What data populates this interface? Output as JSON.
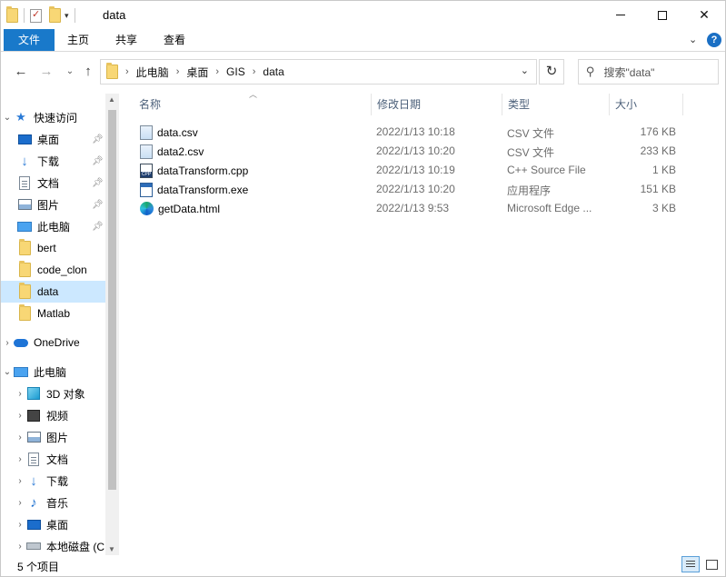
{
  "window": {
    "title": "data"
  },
  "ribbon": {
    "tabs": [
      "文件",
      "主页",
      "共享",
      "查看"
    ]
  },
  "address": {
    "crumbs": [
      "此电脑",
      "桌面",
      "GIS",
      "data"
    ],
    "search_placeholder": "搜索\"data\""
  },
  "sidebar": {
    "quick_access": "快速访问",
    "pinned": [
      {
        "label": "桌面",
        "icon": "desktop-icon"
      },
      {
        "label": "下载",
        "icon": "download-icon"
      },
      {
        "label": "文档",
        "icon": "documents-icon"
      },
      {
        "label": "图片",
        "icon": "pictures-icon"
      },
      {
        "label": "此电脑",
        "icon": "this-pc-icon"
      }
    ],
    "folders": [
      "bert",
      "code_clon",
      "data",
      "Matlab"
    ],
    "onedrive": "OneDrive",
    "this_pc": "此电脑",
    "pc_items": [
      "3D 对象",
      "视频",
      "图片",
      "文档",
      "下载",
      "音乐",
      "桌面",
      "本地磁盘 (C"
    ]
  },
  "columns": {
    "name": "名称",
    "date": "修改日期",
    "type": "类型",
    "size": "大小"
  },
  "files": [
    {
      "name": "data.csv",
      "date": "2022/1/13 10:18",
      "type": "CSV 文件",
      "size": "176 KB",
      "icon": "csv-file-icon"
    },
    {
      "name": "data2.csv",
      "date": "2022/1/13 10:20",
      "type": "CSV 文件",
      "size": "233 KB",
      "icon": "csv-file-icon"
    },
    {
      "name": "dataTransform.cpp",
      "date": "2022/1/13 10:19",
      "type": "C++ Source File",
      "size": "1 KB",
      "icon": "cpp-file-icon"
    },
    {
      "name": "dataTransform.exe",
      "date": "2022/1/13 10:20",
      "type": "应用程序",
      "size": "151 KB",
      "icon": "exe-file-icon"
    },
    {
      "name": "getData.html",
      "date": "2022/1/13 9:53",
      "type": "Microsoft Edge ...",
      "size": "3 KB",
      "icon": "edge-html-icon"
    }
  ],
  "status": {
    "count": "5 个项目"
  }
}
